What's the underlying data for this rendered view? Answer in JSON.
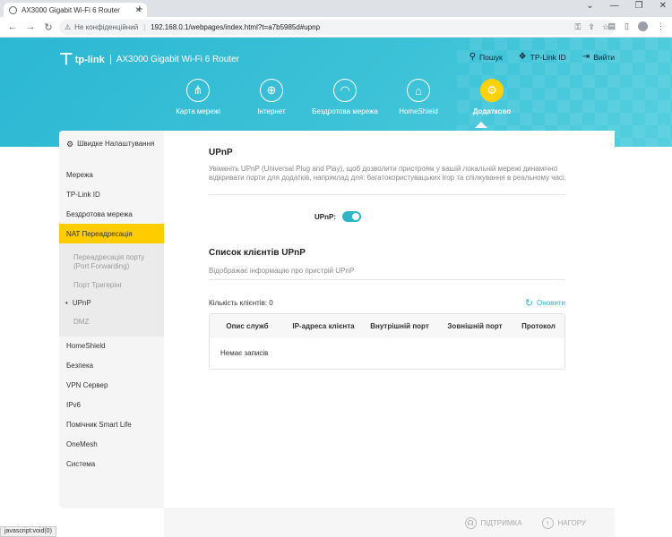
{
  "browser": {
    "tab_title": "AX3000 Gigabit Wi-Fi 6 Router",
    "insecure_label": "Не конфіденційний",
    "url": "192.168.0.1/webpages/index.html?t=a7b5985d#upnp",
    "status_tip": "javascript:void(0)"
  },
  "header": {
    "brand": "tp-link",
    "model": "AX3000 Gigabit Wi-Fi 6 Router",
    "links": {
      "search": "Пошук",
      "tplink_id": "TP-Link ID",
      "logout": "Вийти"
    }
  },
  "menu": [
    {
      "label": "Карта мережі",
      "icon": "network-map-icon"
    },
    {
      "label": "Інтернет",
      "icon": "globe-icon"
    },
    {
      "label": "Бездротова мережа",
      "icon": "wifi-icon"
    },
    {
      "label": "HomeShield",
      "icon": "homeshield-icon"
    },
    {
      "label": "Додатково",
      "icon": "gear-icon",
      "active": true
    }
  ],
  "sidebar": {
    "quick_setup": "Швидке Налаштування",
    "items_top": [
      "Мережа",
      "TP-Link ID",
      "Бездротова мережа"
    ],
    "active": "NAT Переадресація",
    "sub": [
      "Переадресація порту (Port Forwarding)",
      "Порт Тригерінг",
      "UPnP",
      "DMZ"
    ],
    "items_bottom": [
      "HomeShield",
      "Безпека",
      "VPN Сервер",
      "IPv6",
      "Помічник Smart Life",
      "OneMesh",
      "Система"
    ]
  },
  "main": {
    "title": "UPnP",
    "description": "Увімкніть UPnP (Universal Plug and Play), щоб дозволити пристроям у вашій локальній мережі динамічно відкривати порти для додатків, наприклад для: багатокористувацьких ігор та спілкування в реальному часі.",
    "upnp_label": "UPnP:",
    "upnp_enabled": true,
    "clients_title": "Список клієнтів UPnP",
    "clients_desc": "Відображає інформацію про пристрій UPnP",
    "count_label": "Кількість клієнтів: 0",
    "refresh_label": "Оновити",
    "columns": [
      "Опис служб",
      "IP-адреса клієнта",
      "Внутрішній порт",
      "Зовнішній порт",
      "Протокол"
    ],
    "empty_text": "Немає записів"
  },
  "footer": {
    "support": "ПІДТРИМКА",
    "top": "НАГОРУ"
  },
  "colors": {
    "accent": "#32b4c8",
    "active": "#ffcc00"
  }
}
